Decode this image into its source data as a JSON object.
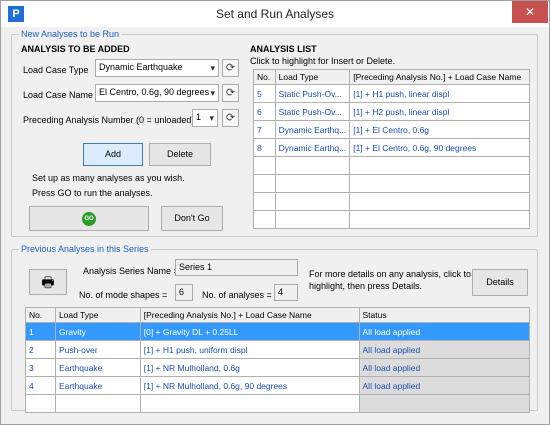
{
  "window": {
    "title": "Set and Run Analyses",
    "app_icon_letter": "P",
    "close_glyph": "✕"
  },
  "new_group": {
    "title": "New Analyses to be Run",
    "to_add_heading": "ANALYSIS TO BE ADDED",
    "load_case_type": {
      "label": "Load Case Type",
      "value": "Dynamic Earthquake"
    },
    "load_case_name": {
      "label": "Load Case Name",
      "value": "El Centro, 0.6g, 90 degrees"
    },
    "preceding": {
      "label": "Preceding Analysis Number (0 = unloaded)",
      "value": "1"
    },
    "add_label": "Add",
    "delete_label": "Delete",
    "hint1": "Set up as many analyses as you wish.",
    "hint2": "Press GO to run the analyses.",
    "go_label": "GO",
    "dont_go_label": "Don't Go",
    "list_heading": "ANALYSIS LIST",
    "list_hint": "Click to highlight for Insert or Delete.",
    "list_columns": [
      "No.",
      "Load Type",
      "[Preceding Analysis No.] + Load Case Name"
    ],
    "list_rows": [
      [
        "5",
        "Static Push-Ov...",
        "[1] + H1 push, linear displ"
      ],
      [
        "6",
        "Static Push-Ov...",
        "[1] + H2 push, linear displ"
      ],
      [
        "7",
        "Dynamic Earthq...",
        "[1] + El Centro, 0.6g"
      ],
      [
        "8",
        "Dynamic Earthq...",
        "[1] + El Centro, 0.6g, 90 degrees"
      ]
    ]
  },
  "prev_group": {
    "title": "Previous Analyses in this Series",
    "series_label": "Analysis Series Name =",
    "series_value": "Series 1",
    "modes_label": "No. of mode shapes =",
    "modes_value": "6",
    "analyses_label": "No. of analyses =",
    "analyses_value": "4",
    "details_text1": "For more details on any analysis, click to",
    "details_text2": "highlight, then press Details.",
    "details_label": "Details",
    "columns": [
      "No.",
      "Load Type",
      "[Preceding Analysis No.] + Load Case Name",
      "Status"
    ],
    "rows": [
      [
        "1",
        "Gravity",
        "[0] + Gravity DL + 0.25LL",
        "All load applied"
      ],
      [
        "2",
        "Push-over",
        "[1] + H1 push, uniform displ",
        "All load applied"
      ],
      [
        "3",
        "Earthquake",
        "[1] + NR Mulholland, 0.6g",
        "All load applied"
      ],
      [
        "4",
        "Earthquake",
        "[1] + NR Mulholland, 0.6g, 90 degrees",
        "All load applied"
      ]
    ]
  }
}
